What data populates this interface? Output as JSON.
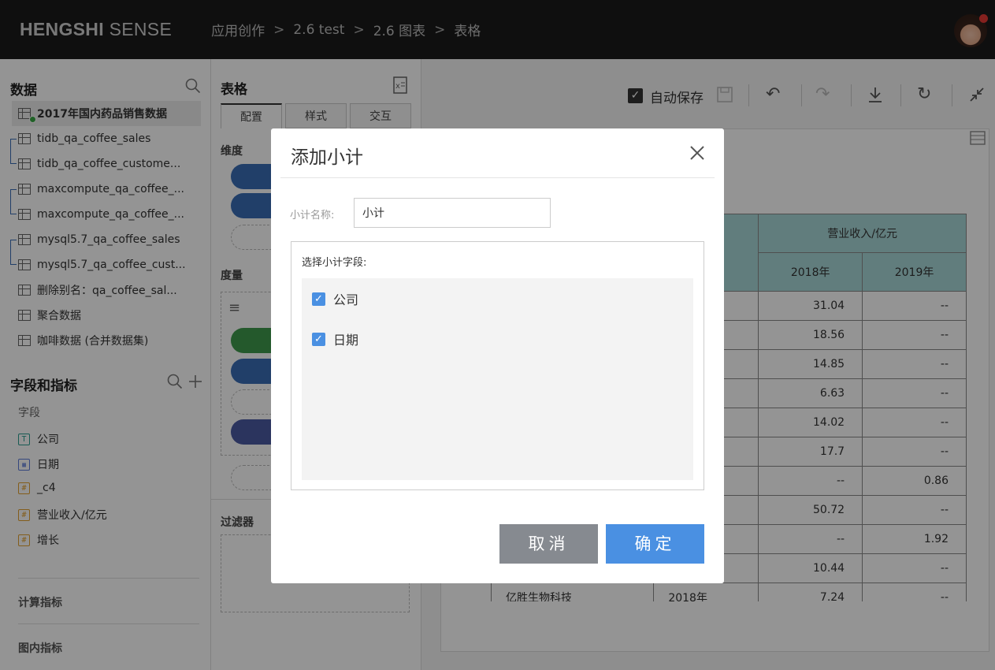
{
  "header": {
    "logo_bold": "HENGSHI",
    "logo_light": "SENSE",
    "breadcrumbs": [
      "应用创作",
      "2.6 test",
      "2.6 图表",
      "表格"
    ],
    "separator": ">"
  },
  "left": {
    "data_title": "数据",
    "datasets": [
      "2017年国内药品销售数据",
      "tidb_qa_coffee_sales",
      "tidb_qa_coffee_custome...",
      "maxcompute_qa_coffee_...",
      "maxcompute_qa_coffee_...",
      "mysql5.7_qa_coffee_sales",
      "mysql5.7_qa_coffee_cust...",
      "删除别名：qa_coffee_sal...",
      "聚合数据",
      "咖啡数据 (合并数据集)"
    ],
    "fields_title": "字段和指标",
    "fields_sub": "字段",
    "fields": [
      {
        "label": "公司",
        "type": "T"
      },
      {
        "label": "日期",
        "type": "D"
      },
      {
        "label": "_c4",
        "type": "#"
      },
      {
        "label": "营业收入/亿元",
        "type": "#"
      },
      {
        "label": "增长",
        "type": "#"
      }
    ],
    "calc_title": "计算指标",
    "chart_metric_title": "图内指标"
  },
  "mid": {
    "title": "表格",
    "tabs": [
      "配置",
      "样式",
      "交互"
    ],
    "dimension_label": "维度",
    "measure_label": "度量",
    "filter_label": "过滤器"
  },
  "toolbar": {
    "autosave_label": "自动保存"
  },
  "table": {
    "header_group": "营业收入/亿元",
    "years": [
      "2018年",
      "2019年"
    ],
    "rows": [
      [
        "31.04",
        "--"
      ],
      [
        "18.56",
        "--"
      ],
      [
        "14.85",
        "--"
      ],
      [
        "6.63",
        "--"
      ],
      [
        "14.02",
        "--"
      ],
      [
        "17.7",
        "--"
      ],
      [
        "--",
        "0.86"
      ],
      [
        "50.72",
        "--"
      ],
      [
        "--",
        "1.92"
      ],
      [
        "10.44",
        "--"
      ]
    ],
    "last_row": {
      "company": "亿胜生物科技",
      "year": "2018年",
      "v1": "7.24",
      "v2": "--"
    }
  },
  "modal": {
    "title": "添加小计",
    "name_label": "小计名称:",
    "name_value": "小计",
    "select_label": "选择小计字段:",
    "options": [
      "公司",
      "日期"
    ],
    "cancel": "取消",
    "ok": "确定"
  },
  "colors": {
    "accent": "#4a90e2",
    "header_bg": "#1b1b1b",
    "table_head": "#a7d7d7"
  }
}
